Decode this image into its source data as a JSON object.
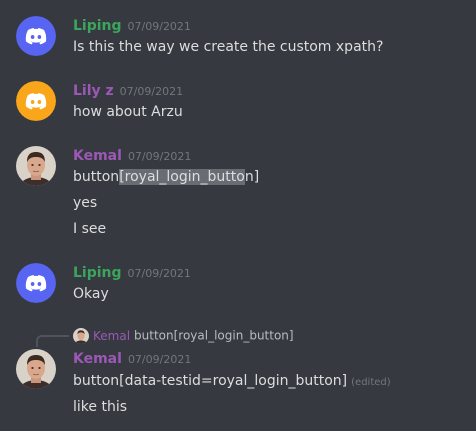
{
  "colors": {
    "background": "#36393f",
    "discord_blurple": "#5865f2",
    "discord_yellow": "#faa61a",
    "liping_name": "#3ba55c",
    "purple_name": "#9b59b6",
    "timestamp": "#72767d",
    "highlight": "#686d73"
  },
  "messages": [
    {
      "author": "Liping",
      "avatar_icon": "discord-logo-icon",
      "timestamp": "07/09/2021",
      "lines": [
        "Is this the way we create the custom xpath?"
      ]
    },
    {
      "author": "Lily z",
      "avatar_icon": "discord-logo-icon",
      "timestamp": "07/09/2021",
      "lines": [
        "how about Arzu"
      ]
    },
    {
      "author": "Kemal",
      "avatar_icon": "user-photo-icon",
      "timestamp": "07/09/2021",
      "line1_pre": "button",
      "line1_highlight": "[royal_login_butto",
      "line1_post": "n]",
      "lines": [
        "yes",
        "I see"
      ]
    },
    {
      "author": "Liping",
      "avatar_icon": "discord-logo-icon",
      "timestamp": "07/09/2021",
      "lines": [
        "Okay"
      ]
    },
    {
      "author": "Kemal",
      "avatar_icon": "user-photo-icon",
      "timestamp": "07/09/2021",
      "reply": {
        "author": "Kemal",
        "text": "button[royal_login_button]"
      },
      "lines": [
        "button[data-testid=royal_login_button]",
        "like this"
      ],
      "edited_label": "(edited)"
    }
  ]
}
